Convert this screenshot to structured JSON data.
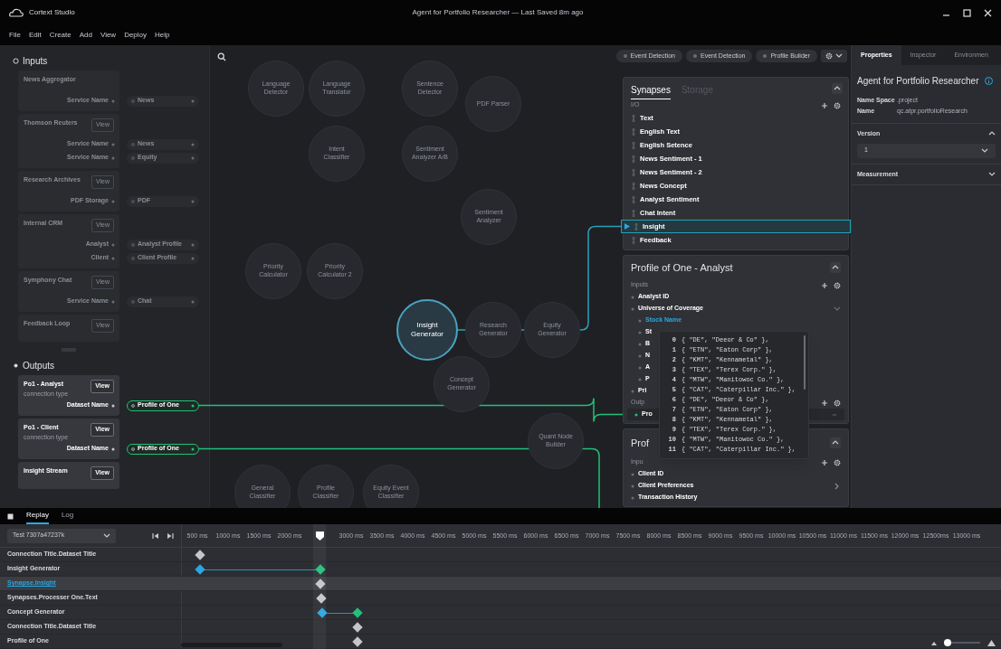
{
  "window": {
    "app_name": "Cortext Studio",
    "title": "Agent for Portfolio Researcher — Last Saved 8m ago"
  },
  "menu": [
    "File",
    "Edit",
    "Create",
    "Add",
    "View",
    "Deploy",
    "Help"
  ],
  "inputs": {
    "title": "Inputs",
    "cards": [
      {
        "title": "News Aggregator",
        "disabled": true,
        "rows": [
          {
            "field": "Service Name",
            "target": "News",
            "connected": false
          }
        ]
      },
      {
        "title": "Thomson Reuters",
        "button": "View",
        "disabled": true,
        "rows": [
          {
            "field": "Service Name",
            "target": "News",
            "connected": false
          },
          {
            "field": "Service Name",
            "target": "Equity",
            "connected": false
          }
        ]
      },
      {
        "title": "Research Archives",
        "button": "View",
        "disabled": true,
        "rows": [
          {
            "field": "PDF Storage",
            "target": "PDF",
            "connected": false
          }
        ]
      },
      {
        "title": "Internal CRM",
        "button": "View",
        "disabled": true,
        "rows": [
          {
            "field": "Analyst",
            "target": "Analyst Profile",
            "connected": false
          },
          {
            "field": "Client",
            "target": "Client Profile",
            "connected": false
          }
        ]
      },
      {
        "title": "Symphony Chat",
        "button": "View",
        "disabled": true,
        "rows": [
          {
            "field": "Service Name",
            "target": "Chat",
            "connected": false
          }
        ]
      },
      {
        "title": "Feedback Loop",
        "button": "View",
        "disabled": true
      }
    ]
  },
  "outputs": {
    "title": "Outputs",
    "cards": [
      {
        "title": "Po1 - Analyst",
        "subtitle": "connection type",
        "button": "View",
        "disabled": false,
        "rows": [
          {
            "field": "Dataset Name",
            "target": "Profile of One",
            "connected": true
          }
        ]
      },
      {
        "title": "Po1 - Client",
        "subtitle": "connection type",
        "button": "View",
        "disabled": false,
        "rows": [
          {
            "field": "Dataset Name",
            "target": "Profile of One",
            "connected": true
          }
        ]
      },
      {
        "title": "Insight Stream",
        "button": "View",
        "disabled": false
      }
    ]
  },
  "canvas": {
    "nodes": [
      {
        "label": "Language Detector",
        "selected": false
      },
      {
        "label": "Language Translator",
        "selected": false
      },
      {
        "label": "Sentence Detector",
        "selected": false
      },
      {
        "label": "PDF Parser",
        "selected": false
      },
      {
        "label": "Intent Classifier",
        "selected": false
      },
      {
        "label": "Sentiment Analyzer A/B",
        "selected": false
      },
      {
        "label": "Sentiment Analyzer",
        "selected": false
      },
      {
        "label": "Priority Calculator",
        "selected": false
      },
      {
        "label": "Priority Calculator 2",
        "selected": false
      },
      {
        "label": "Insight Generator",
        "selected": true
      },
      {
        "label": "Research Generator",
        "selected": false
      },
      {
        "label": "Equity Generator",
        "selected": false
      },
      {
        "label": "Concept Generator",
        "selected": false
      },
      {
        "label": "Quant Node Builder",
        "selected": false
      },
      {
        "label": "General Classifier",
        "selected": false
      },
      {
        "label": "Profile Classifier",
        "selected": false
      },
      {
        "label": "Equity Event Classifier",
        "selected": false
      }
    ]
  },
  "toolbar": {
    "chips": [
      "Event Detection",
      "Event Detection",
      "Profile Builder"
    ]
  },
  "synapses": {
    "tabs": [
      {
        "label": "Synapses",
        "selected": true
      },
      {
        "label": "Storage",
        "selected": false
      }
    ],
    "section": "I/O",
    "items": [
      {
        "label": "Text",
        "selected": false
      },
      {
        "label": "English Text",
        "selected": false
      },
      {
        "label": "English Setence",
        "selected": false
      },
      {
        "label": "News Sentiment - 1",
        "selected": false
      },
      {
        "label": "News Sentiment - 2",
        "selected": false
      },
      {
        "label": "News Concept",
        "selected": false
      },
      {
        "label": "Analyst Sentiment",
        "selected": false
      },
      {
        "label": "Chat Intent",
        "selected": false
      },
      {
        "label": "Insight",
        "selected": true
      },
      {
        "label": "Feedback",
        "selected": false
      }
    ]
  },
  "profile_analyst": {
    "title": "Profile of One - Analyst",
    "inputs_label": "Inputs",
    "inputs": [
      {
        "label": "Analyst ID",
        "selected": false
      },
      {
        "label": "Universe of Coverage",
        "selected": false,
        "expanded": true,
        "children": [
          {
            "label": "Stock Name",
            "selected": true
          },
          {
            "label": "St",
            "selected": false
          },
          {
            "label": "B",
            "selected": false
          },
          {
            "label": "N",
            "selected": false
          },
          {
            "label": "A",
            "selected": false
          },
          {
            "label": "P",
            "selected": false
          }
        ]
      },
      {
        "label": "Pri",
        "selected": false
      }
    ],
    "outputs_label": "Outp",
    "outputs": [
      {
        "label": "Pro",
        "selected": false
      }
    ]
  },
  "value_popup": {
    "rows": [
      {
        "index": "0",
        "value": "{ \"DE\", \"Deeor & Co\" },"
      },
      {
        "index": "1",
        "value": "{ \"ETN\", \"Eaton Corp\" },"
      },
      {
        "index": "2",
        "value": "{ \"KMT\", \"Kennametal\" },"
      },
      {
        "index": "3",
        "value": "{ \"TEX\", \"Terex Corp.\" },"
      },
      {
        "index": "4",
        "value": "{ \"MTW\", \"Manitowoc Co.\" },"
      },
      {
        "index": "5",
        "value": "{ \"CAT\", \"Caterpillar Inc.\" },"
      },
      {
        "index": "6",
        "value": "{ \"DE\", \"Deeor & Co\" },"
      },
      {
        "index": "7",
        "value": "{ \"ETN\", \"Eaton Corp\" },"
      },
      {
        "index": "8",
        "value": "{ \"KMT\", \"Kennametal\" },"
      },
      {
        "index": "9",
        "value": "{ \"TEX\", \"Terex Corp.\" },"
      },
      {
        "index": "10",
        "value": "{ \"MTW\", \"Manitowoc Co.\" },"
      },
      {
        "index": "11",
        "value": "{ \"CAT\", \"Caterpillar Inc.\" },"
      }
    ]
  },
  "profile_client": {
    "title": "Prof",
    "inputs_label": "Inpu",
    "inputs": [
      {
        "label": "Client ID",
        "selected": false
      },
      {
        "label": "Client Preferences",
        "selected": false,
        "expanded": false
      },
      {
        "label": "Transaction History",
        "selected": false
      }
    ]
  },
  "properties": {
    "tabs": [
      {
        "label": "Properties",
        "selected": true
      },
      {
        "label": "Inspector",
        "selected": false
      },
      {
        "label": "Environmen",
        "selected": false
      }
    ],
    "title": "Agent for Portfolio Researcher",
    "fields": [
      {
        "label": "Name Space",
        "value": ".project"
      },
      {
        "label": "Name",
        "value": "qc.atpr.portfolioResearch"
      }
    ],
    "sections": [
      {
        "title": "Version",
        "expanded": true,
        "value": "1"
      },
      {
        "title": "Measurement",
        "expanded": false
      }
    ]
  },
  "replay": {
    "tabs": [
      {
        "label": "Replay",
        "selected": true
      },
      {
        "label": "Log",
        "selected": false
      }
    ],
    "run_select": "Test 7307a47237k",
    "ticks": [
      "500 ms",
      "1000 ms",
      "1500 ms",
      "2000 ms",
      "3000 ms",
      "3500 ms",
      "4000 ms",
      "4500 ms",
      "5000 ms",
      "5500 ms",
      "6000 ms",
      "6500 ms",
      "7000 ms",
      "7500 ms",
      "8000 ms",
      "8500 ms",
      "9000 ms",
      "9500 ms",
      "10000 ms",
      "10500 ms",
      "11000 ms",
      "11500 ms",
      "12000 ms",
      "12500ms",
      "13000 ms"
    ],
    "rows": [
      {
        "label": "Connection Title.Dataset Title",
        "selected": false,
        "events": [
          {
            "kind": "marker"
          }
        ]
      },
      {
        "label": "Insight Generator",
        "selected": false,
        "events": [
          {
            "kind": "start"
          },
          {
            "kind": "end"
          }
        ]
      },
      {
        "label": "Synapse.Insight",
        "selected": true,
        "events": [
          {
            "kind": "marker"
          }
        ]
      },
      {
        "label": "Synapses.Processer One.Text",
        "selected": false,
        "events": [
          {
            "kind": "marker"
          }
        ]
      },
      {
        "label": "Concept Generator",
        "selected": false,
        "events": [
          {
            "kind": "start"
          },
          {
            "kind": "end"
          }
        ]
      },
      {
        "label": "Connection Title.Dataset Title",
        "selected": false,
        "events": [
          {
            "kind": "marker"
          }
        ]
      },
      {
        "label": "Profile of One",
        "selected": false,
        "events": [
          {
            "kind": "marker"
          }
        ]
      }
    ],
    "zoom": {
      "level": 0.1
    }
  }
}
